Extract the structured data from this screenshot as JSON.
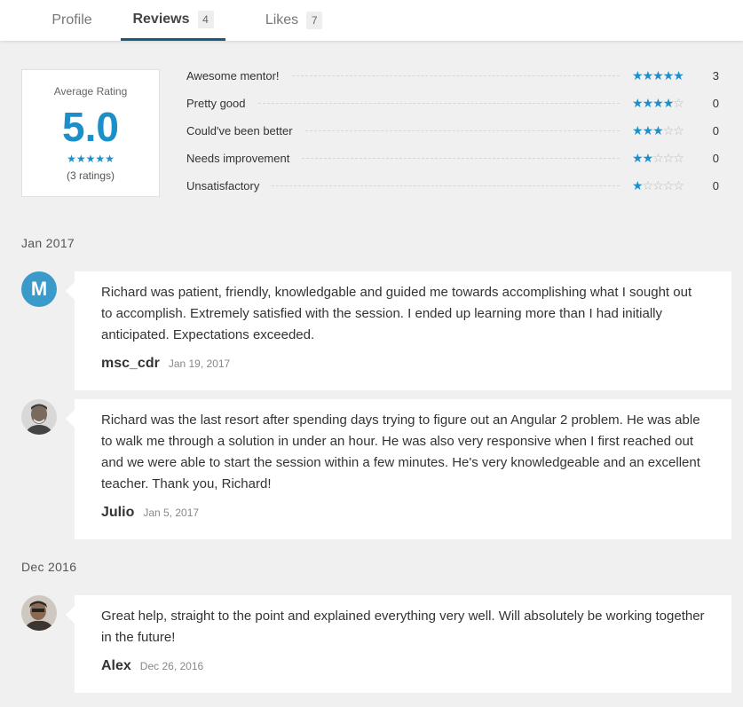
{
  "tabs": [
    {
      "label": "Profile",
      "count": null
    },
    {
      "label": "Reviews",
      "count": "4"
    },
    {
      "label": "Likes",
      "count": "7"
    }
  ],
  "summary": {
    "label": "Average Rating",
    "score": "5.0",
    "stars": 5,
    "count_text": "(3 ratings)"
  },
  "breakdown": [
    {
      "label": "Awesome mentor!",
      "stars": 5,
      "count": "3"
    },
    {
      "label": "Pretty good",
      "stars": 4,
      "count": "0"
    },
    {
      "label": "Could've been better",
      "stars": 3,
      "count": "0"
    },
    {
      "label": "Needs improvement",
      "stars": 2,
      "count": "0"
    },
    {
      "label": "Unsatisfactory",
      "stars": 1,
      "count": "0"
    }
  ],
  "groups": [
    {
      "month": "Jan 2017"
    },
    {
      "month": "Dec 2016"
    }
  ],
  "reviews": [
    {
      "avatar": "M",
      "text": "Richard was patient, friendly, knowledgable and guided me towards accomplishing what I sought out to accomplish. Extremely satisfied with the session. I ended up learning more than I had initially anticipated. Expectations exceeded.",
      "author": "msc_cdr",
      "date": "Jan 19, 2017"
    },
    {
      "avatar": "photo",
      "text": "Richard was the last resort after spending days trying to figure out an Angular 2 problem. He was able to walk me through a solution in under an hour. He was also very responsive when I first reached out and we were able to start the session within a few minutes. He's very knowledgeable and an excellent teacher. Thank you, Richard!",
      "author": "Julio",
      "date": "Jan 5, 2017"
    },
    {
      "avatar": "photo",
      "text": "Great help, straight to the point and explained everything very well. Will absolutely be working together in the future!",
      "author": "Alex",
      "date": "Dec 26, 2016"
    }
  ],
  "colors": {
    "accent": "#1c8fc8",
    "tab_underline": "#1a5a7e",
    "background": "#f0f0f0"
  }
}
